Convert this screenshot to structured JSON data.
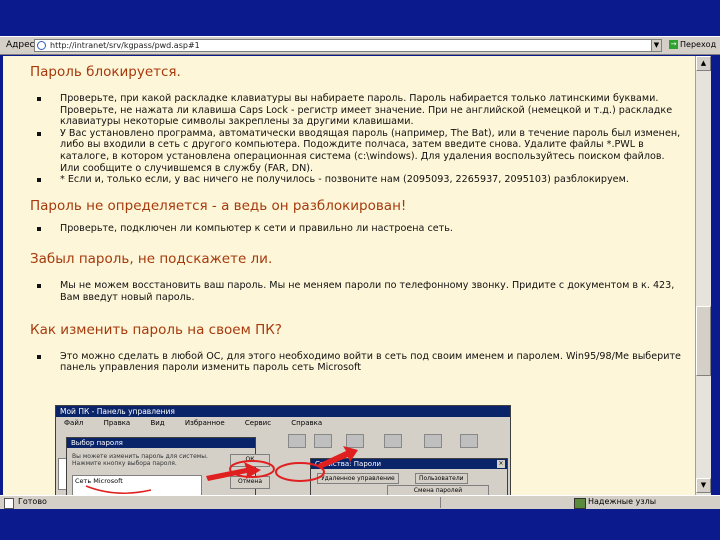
{
  "address_bar": {
    "label": "Адрес",
    "url": "http://intranet/srv/kgpass/pwd.asp#1",
    "go_label": "Переход"
  },
  "sections": [
    {
      "heading": "Пароль блокируется.",
      "items": [
        "Проверьте, при какой раскладке клавиатуры вы набираете пароль. Пароль набирается только латинскими буквами. Проверьте, не нажата ли клавиша Caps Lock - регистр имеет значение. При не английской (немецкой и т.д.) раскладке клавиатуры некоторые символы закреплены за другими клавишами.",
        "У Вас установлено программа, автоматически вводящая пароль (например, The Bat), или в течение пароль был изменен, либо вы входили в сеть с другого компьютера. Подождите полчаса, затем введите снова. Удалите файлы *.PWL в каталоге, в котором установлена операционная система (c:\\windows). Для удаления воспользуйтесь поиском файлов. Или сообщите о случившемся в службу (FAR, DN).",
        "* Если и, только если, у вас ничего не получилось - позвоните нам (2095093, 2265937, 2095103) разблокируем."
      ]
    },
    {
      "heading": "Пароль не определяется - а ведь он разблокирован!",
      "items": [
        "Проверьте, подключен ли компьютер к сети и правильно ли настроена сеть."
      ]
    },
    {
      "heading": "Забыл пароль, не подскажете ли.",
      "items": [
        "Мы не можем восстановить ваш пароль. Мы не меняем пароли по телефонному звонку. Придите с документом в к. 423, Вам введут новый пароль."
      ]
    },
    {
      "heading": "Как изменить пароль на своем ПК?",
      "items": [
        "Это можно сделать в любой ОС, для этого необходимо войти в сеть под своим именем и паролем. Win95/98/Me выберите панель управления пароли изменить пароль сеть Microsoft"
      ]
    }
  ],
  "embedded_screenshot": {
    "window_title": "Мой ПК - Панель управления",
    "menu": [
      "Файл",
      "Правка",
      "Вид",
      "Избранное",
      "Сервис",
      "Справка"
    ],
    "dialog1_title": "Выбор пароля",
    "dialog1_text": "Вы можете изменить пароль для системы. Нажмите кнопку выбора пароля.",
    "dialog1_list_item": "Сеть Microsoft",
    "dialog1_btn_ok": "ОК",
    "dialog1_btn_cancel": "Отмена",
    "dialog2_title": "Свойства: Пароли",
    "dialog2_tabs": [
      "Удаленное управление",
      "Пользователи"
    ],
    "dialog2_field": "Смена паролей"
  },
  "status_bar": {
    "ready": "Готово",
    "zone": "Надежные узлы"
  },
  "colors": {
    "page_background": "#fef6d8",
    "heading": "#a53a0d",
    "frame": "#0b1a8c",
    "annotation_arrow": "#e02020"
  }
}
